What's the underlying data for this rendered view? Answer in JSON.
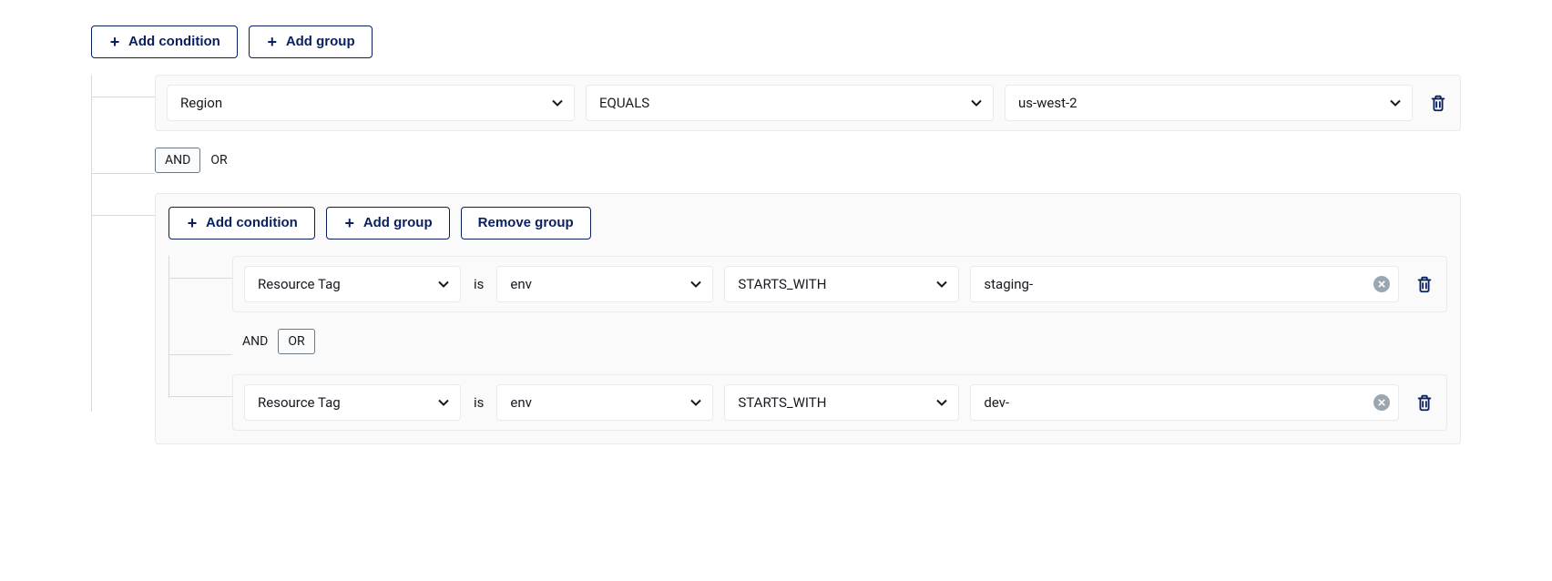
{
  "buttons": {
    "add_condition": "Add condition",
    "add_group": "Add group",
    "remove_group": "Remove group"
  },
  "operators": {
    "and": "AND",
    "or": "OR"
  },
  "root": {
    "condition1": {
      "field": "Region",
      "operator": "EQUALS",
      "value": "us-west-2"
    },
    "connector_active": "AND",
    "group": {
      "condition1": {
        "field": "Resource Tag",
        "keyword_is": "is",
        "tag_key": "env",
        "operator": "STARTS_WITH",
        "value": "staging-"
      },
      "connector_active": "OR",
      "condition2": {
        "field": "Resource Tag",
        "keyword_is": "is",
        "tag_key": "env",
        "operator": "STARTS_WITH",
        "value": "dev-"
      }
    }
  }
}
